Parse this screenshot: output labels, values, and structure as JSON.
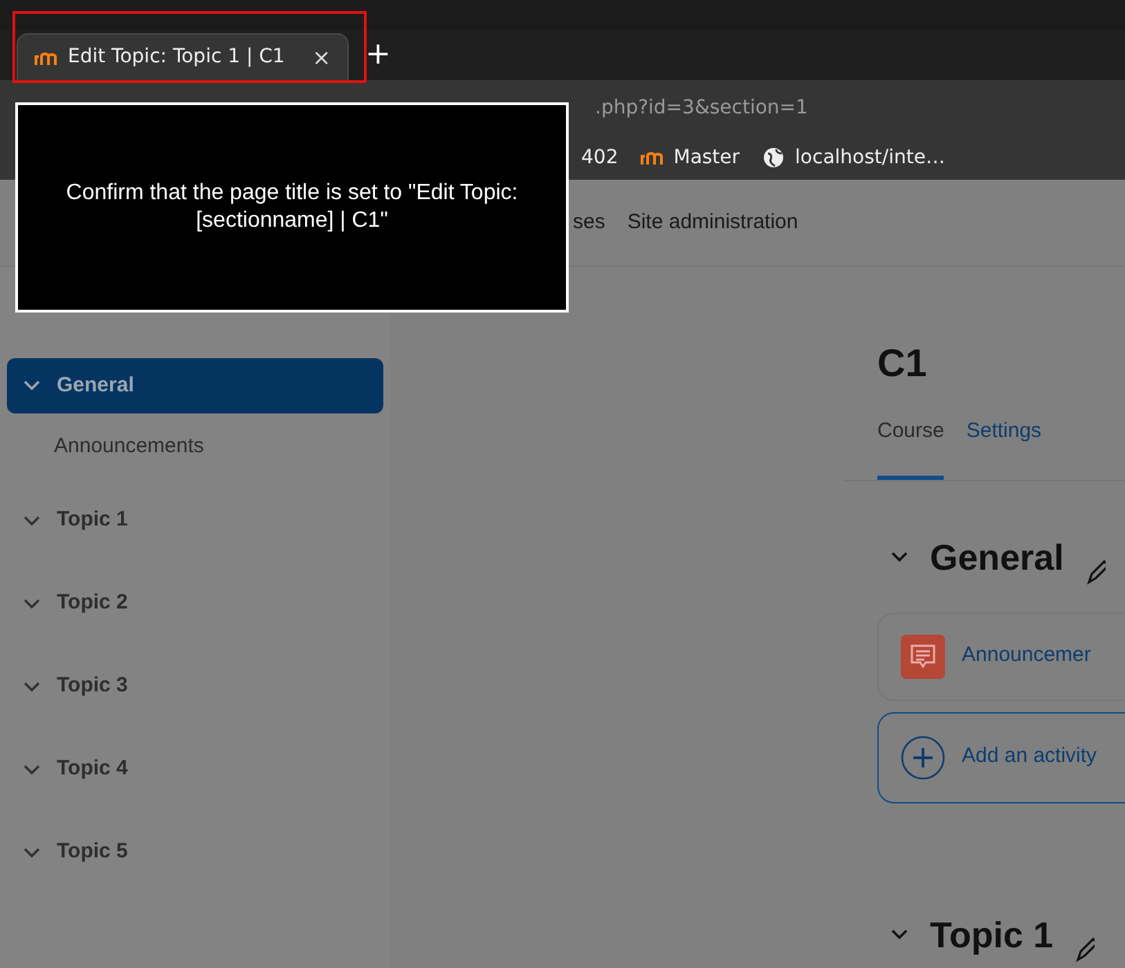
{
  "browser": {
    "tab": {
      "title": "Edit Topic: Topic 1 | C1",
      "close": "×",
      "selected": true
    },
    "new_tab": "+",
    "url": ".php?id=3&section=1",
    "bookmarks": [
      {
        "kind": "plain",
        "label": "402"
      },
      {
        "kind": "moodle",
        "label": "Master"
      },
      {
        "kind": "globe",
        "label": "localhost/inte…"
      }
    ]
  },
  "overlay": {
    "message": "Confirm that the page title is set to \"Edit Topic: [sectionname] | C1\""
  },
  "navbar": {
    "items": [
      "ses",
      "Site administration"
    ]
  },
  "sidebar": {
    "items": [
      {
        "label": "General",
        "selected": true,
        "children": [
          {
            "label": "Announcements"
          }
        ]
      },
      {
        "label": "Topic 1",
        "selected": false
      },
      {
        "label": "Topic 2",
        "selected": false
      },
      {
        "label": "Topic 3",
        "selected": false
      },
      {
        "label": "Topic 4",
        "selected": false
      },
      {
        "label": "Topic 5",
        "selected": false
      }
    ]
  },
  "course": {
    "title": "C1",
    "tabs": [
      {
        "label": "Course",
        "selected": true
      },
      {
        "label": "Settings",
        "selected": false
      }
    ],
    "sections": [
      {
        "title": "General",
        "activities": [
          {
            "kind": "forum",
            "label": "Announcemer"
          },
          {
            "kind": "add",
            "label": "Add an activity"
          }
        ]
      },
      {
        "title": "Topic 1"
      }
    ]
  }
}
